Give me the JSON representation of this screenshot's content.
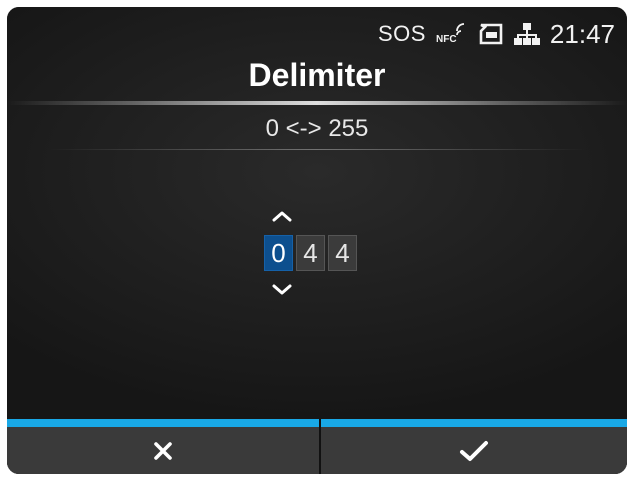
{
  "status_bar": {
    "sos": "SOS",
    "nfc_icon": "nfc-icon",
    "sd_card_icon": "sd-card-icon",
    "network_icon": "network-icon",
    "time": "21:47"
  },
  "screen": {
    "title": "Delimiter",
    "range": "0 <-> 255"
  },
  "value_input": {
    "up_icon": "chevron-up-icon",
    "down_icon": "chevron-down-icon",
    "digits": [
      "0",
      "4",
      "4"
    ],
    "selected_index": 0
  },
  "bottom_bar": {
    "cancel_icon": "close-icon",
    "confirm_icon": "check-icon"
  },
  "colors": {
    "accent": "#19a8e6",
    "selected_digit": "#0d4f8e",
    "background": "#1d1d1d"
  }
}
